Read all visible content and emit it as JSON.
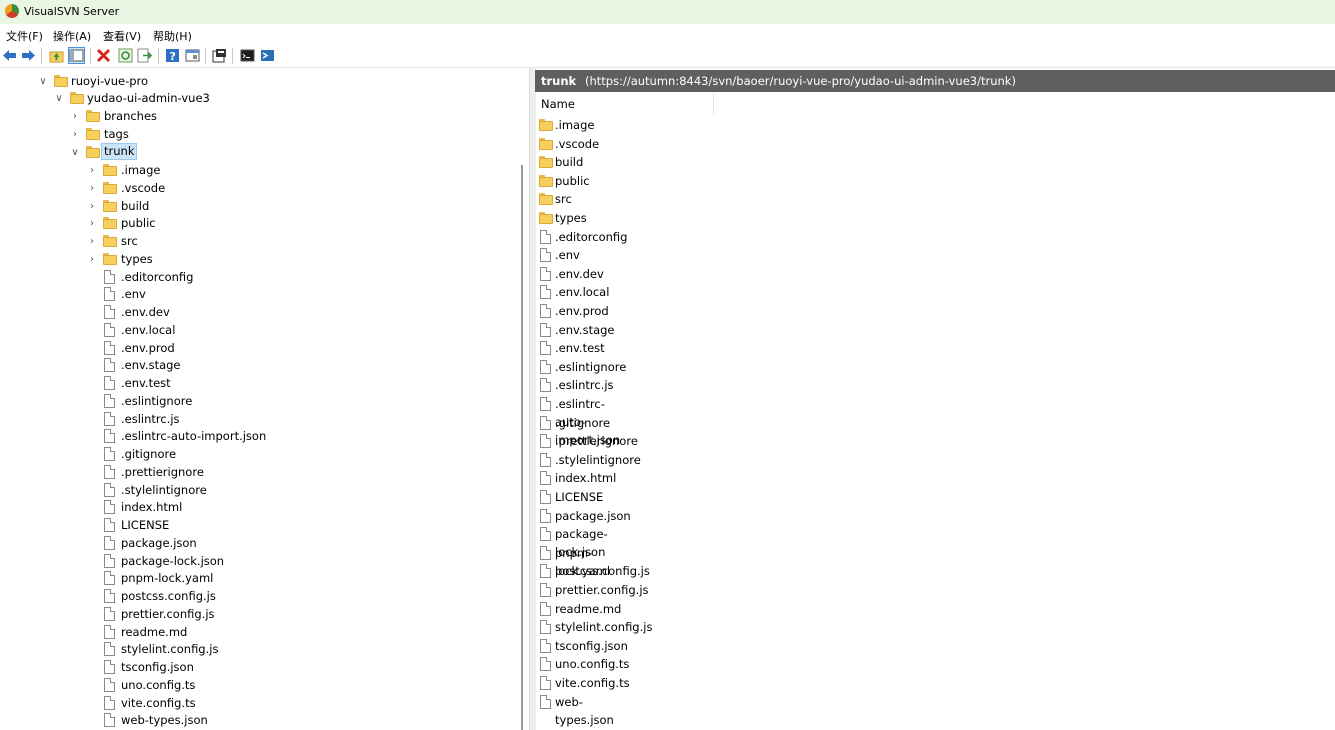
{
  "window": {
    "title": "VisualSVN Server"
  },
  "menu": [
    "文件(F)",
    "操作(A)",
    "查看(V)",
    "帮助(H)"
  ],
  "toolbar": {
    "icons": [
      "back-arrow-icon",
      "forward-arrow-icon",
      "up-folder-icon",
      "show-hide-tree-icon",
      "delete-icon",
      "refresh-icon",
      "export-icon",
      "help-icon",
      "properties-view-icon",
      "properties-icon",
      "command-prompt-icon",
      "powershell-icon"
    ]
  },
  "tree": {
    "repo": "ruoyi-vue-pro",
    "project": "yudao-ui-admin-vue3",
    "branches": "branches",
    "tags": "tags",
    "trunk": "trunk",
    "trunk_folders": [
      ".image",
      ".vscode",
      "build",
      "public",
      "src",
      "types"
    ],
    "trunk_files": [
      ".editorconfig",
      ".env",
      ".env.dev",
      ".env.local",
      ".env.prod",
      ".env.stage",
      ".env.test",
      ".eslintignore",
      ".eslintrc.js",
      ".eslintrc-auto-import.json",
      ".gitignore",
      ".prettierignore",
      ".stylelintignore",
      "index.html",
      "LICENSE",
      "package.json",
      "package-lock.json",
      "pnpm-lock.yaml",
      "postcss.config.js",
      "prettier.config.js",
      "readme.md",
      "stylelint.config.js",
      "tsconfig.json",
      "uno.config.ts",
      "vite.config.ts",
      "web-types.json"
    ]
  },
  "detail": {
    "name": "trunk",
    "url": "(https://autumn:8443/svn/baoer/ruoyi-vue-pro/yudao-ui-admin-vue3/trunk)",
    "column_header": "Name",
    "folders": [
      ".image",
      ".vscode",
      "build",
      "public",
      "src",
      "types"
    ],
    "files": [
      ".editorconfig",
      ".env",
      ".env.dev",
      ".env.local",
      ".env.prod",
      ".env.stage",
      ".env.test",
      ".eslintignore",
      ".eslintrc.js",
      ".eslintrc-auto-import.json",
      ".gitignore",
      ".prettierignore",
      ".stylelintignore",
      "index.html",
      "LICENSE",
      "package.json",
      "package-lock.json",
      "pnpm-lock.yaml",
      "postcss.config.js",
      "prettier.config.js",
      "readme.md",
      "stylelint.config.js",
      "tsconfig.json",
      "uno.config.ts",
      "vite.config.ts",
      "web-types.json"
    ]
  },
  "colors": {
    "titlebar": "#eaf6e4",
    "pathbar": "#5f5f5f",
    "selection": "#cce4f7",
    "folder": "#f6cf5d"
  }
}
